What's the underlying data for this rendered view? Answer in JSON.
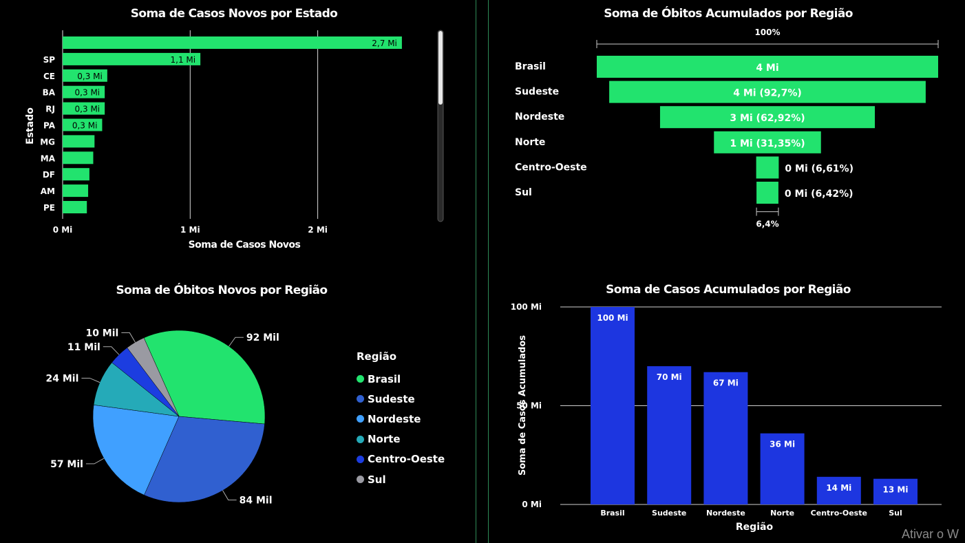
{
  "watermark": "Ativar o W",
  "chart_data": [
    {
      "id": "casos_novos_estado",
      "type": "bar",
      "orientation": "horizontal",
      "title": "Soma de Casos Novos por Estado",
      "xlabel": "Soma de Casos Novos",
      "ylabel": "Estado",
      "xlim": [
        0,
        2.9
      ],
      "xticks": [
        "0 Mi",
        "1 Mi",
        "2 Mi"
      ],
      "categories": [
        "",
        "SP",
        "CE",
        "BA",
        "RJ",
        "PA",
        "MG",
        "MA",
        "DF",
        "AM",
        "PE"
      ],
      "values": [
        2.66,
        1.08,
        0.35,
        0.33,
        0.33,
        0.31,
        0.25,
        0.24,
        0.21,
        0.2,
        0.19
      ],
      "data_labels": [
        "2,7 Mi",
        "1,1 Mi",
        "0,3 Mi",
        "0,3 Mi",
        "0,3 Mi",
        "0,3 Mi",
        "",
        "",
        "",
        "",
        ""
      ],
      "grid": true,
      "color": "#22e36e"
    },
    {
      "id": "obitos_acumulados_regiao",
      "type": "funnel",
      "title": "Soma de Óbitos Acumulados por Região",
      "top_label": "100%",
      "bottom_label": "6,4%",
      "categories": [
        "Brasil",
        "Sudeste",
        "Nordeste",
        "Norte",
        "Centro-Oeste",
        "Sul"
      ],
      "percent": [
        100,
        92.7,
        62.92,
        31.35,
        6.61,
        6.42
      ],
      "data_labels": [
        "4 Mi",
        "4 Mi (92,7%)",
        "3 Mi (62,92%)",
        "1 Mi (31,35%)",
        "0 Mi (6,61%)",
        "0 Mi (6,42%)"
      ],
      "color": "#22e36e"
    },
    {
      "id": "obitos_novos_regiao",
      "type": "pie",
      "title": "Soma de Óbitos Novos por Região",
      "legend_title": "Região",
      "legend_position": "right",
      "categories": [
        "Brasil",
        "Sudeste",
        "Nordeste",
        "Norte",
        "Centro-Oeste",
        "Sul"
      ],
      "values": [
        92,
        84,
        57,
        24,
        11,
        10
      ],
      "data_labels": [
        "92 Mil",
        "84 Mil",
        "57 Mil",
        "24 Mil",
        "11 Mil",
        "10 Mil"
      ],
      "colors": [
        "#22e36e",
        "#3060d0",
        "#40a0ff",
        "#25aab8",
        "#1c3de0",
        "#9a9aa2"
      ]
    },
    {
      "id": "casos_acumulados_regiao",
      "type": "bar",
      "orientation": "vertical",
      "title": "Soma de Casos Acumulados por Região",
      "xlabel": "Região",
      "ylabel": "Soma de Casos Acumulados",
      "ylim": [
        0,
        100
      ],
      "yticks": [
        "0 Mi",
        "50 Mi",
        "100 Mi"
      ],
      "categories": [
        "Brasil",
        "Sudeste",
        "Nordeste",
        "Norte",
        "Centro-Oeste",
        "Sul"
      ],
      "values": [
        100,
        70,
        67,
        36,
        14,
        13
      ],
      "data_labels": [
        "100 Mi",
        "70 Mi",
        "67 Mi",
        "36 Mi",
        "14 Mi",
        "13 Mi"
      ],
      "grid": true,
      "color": "#1d36e0"
    }
  ]
}
